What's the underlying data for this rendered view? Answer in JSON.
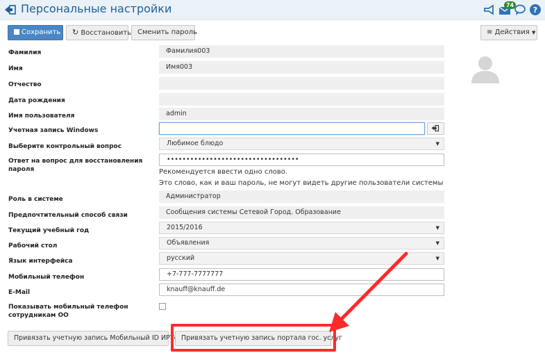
{
  "header": {
    "title": "Персональные настройки",
    "mail_badge": "74",
    "icons": [
      "back-arrow-icon",
      "megaphone-icon",
      "mail-icon",
      "chat-icon",
      "help-icon"
    ]
  },
  "toolbar": {
    "save_label": "Сохранить",
    "restore_label": "Восстановить",
    "change_password_label": "Сменить пароль",
    "actions_label": "Действия"
  },
  "form": {
    "surname": {
      "label": "Фамилия",
      "value": "Фамилия003"
    },
    "name": {
      "label": "Имя",
      "value": "Имя003"
    },
    "patronymic": {
      "label": "Отчество",
      "value": ""
    },
    "birthdate": {
      "label": "Дата рождения",
      "value": ""
    },
    "username": {
      "label": "Имя пользователя",
      "value": "admin"
    },
    "windows_account": {
      "label": "Учетная запись Windows",
      "value": ""
    },
    "security_question": {
      "label": "Выберите контрольный вопрос",
      "value": "Любимое блюдо"
    },
    "security_answer": {
      "label_line1": "Ответ на вопрос для восстановления",
      "label_line2": "пароля",
      "value": "••••••••••••••••••••••••••••••••••"
    },
    "hint_line1": "Рекомендуется ввести одно слово.",
    "hint_line2": "Это слово, как и ваш пароль, не могут видеть другие пользователи системы",
    "role": {
      "label": "Роль в системе",
      "value": "Администратор"
    },
    "contact_method": {
      "label": "Предпочтительный способ связи",
      "value": "Сообщения системы Сетевой Город. Образование"
    },
    "school_year": {
      "label": "Текущий учебный год",
      "value": "2015/2016"
    },
    "desktop": {
      "label": "Рабочий стол",
      "value": "Объявления"
    },
    "language": {
      "label": "Язык интерфейса",
      "value": "русский"
    },
    "mobile": {
      "label": "Мобильный телефон",
      "value": "+7-777-7777777"
    },
    "email": {
      "label": "E-Mail",
      "value": "knauff@knauff.de"
    },
    "show_mobile": {
      "label_line1": "Показывать мобильный телефон",
      "label_line2": "сотрудникам ОО",
      "checked": false
    }
  },
  "bottom": {
    "link_irtech_label": "Привязать учетную запись Мобильный ID ИРТех",
    "link_gosuslugi_label": "Привязать учетную запись портала гос. услуг"
  },
  "colors": {
    "accent": "#4a86c5",
    "title": "#1f5f96",
    "highlight": "#ff2a2a",
    "badge": "#2e8b2e"
  }
}
